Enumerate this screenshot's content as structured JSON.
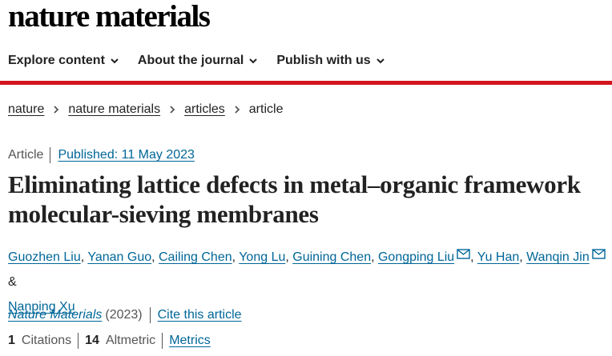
{
  "header": {
    "logo_text": "nature materials",
    "nav": [
      {
        "label": "Explore content"
      },
      {
        "label": "About the journal"
      },
      {
        "label": "Publish with us"
      }
    ],
    "accent_color": "#d3141e"
  },
  "breadcrumb": {
    "items": [
      "nature",
      "nature materials",
      "articles"
    ],
    "current": "article"
  },
  "article": {
    "type": "Article",
    "published": "Published: 11 May 2023",
    "title": "Eliminating lattice defects in metal–organic framework molecular-sieving membranes",
    "authors": [
      {
        "name": "Guozhen Liu",
        "sep": ", "
      },
      {
        "name": "Yanan Guo",
        "sep": ", "
      },
      {
        "name": "Cailing Chen",
        "sep": ", "
      },
      {
        "name": "Yong Lu",
        "sep": ", "
      },
      {
        "name": "Guining Chen",
        "sep": ", "
      },
      {
        "name": "Gongping Liu",
        "sep": ", "
      },
      {
        "name": "Yu Han",
        "sep": ", "
      },
      {
        "name": "Wanqin Jin",
        "sep": " & "
      },
      {
        "name": "Nanping Xu",
        "sep": ""
      }
    ],
    "corresponding_icon": "mail-icon",
    "journal": "Nature Materials",
    "year": "(2023)",
    "cite_label": "Cite this article",
    "citations_count": "1",
    "citations_label": "Citations",
    "altmetric_count": "14",
    "altmetric_label": "Altmetric",
    "metrics_label": "Metrics",
    "link_color": "#006699"
  }
}
